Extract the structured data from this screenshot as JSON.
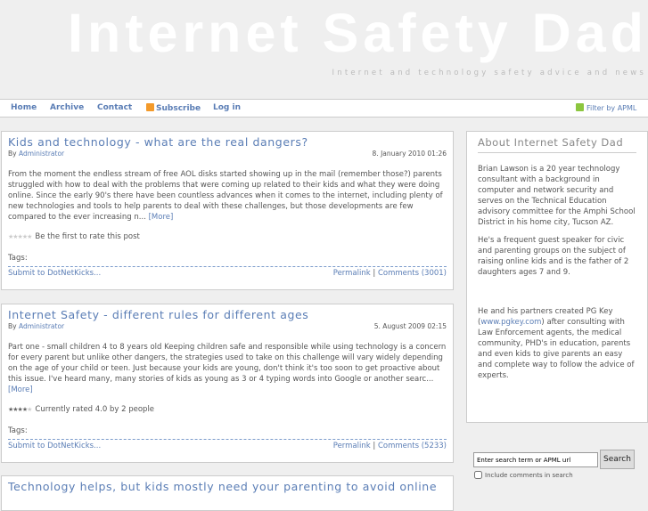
{
  "site": {
    "title": "Internet Safety Dad",
    "tagline": "Internet and technology safety advice and news"
  },
  "nav": {
    "items": [
      "Home",
      "Archive",
      "Contact",
      "Subscribe",
      "Log in"
    ],
    "filter": "Filter by APML"
  },
  "posts": [
    {
      "title": "Kids and technology - what are the real dangers?",
      "by": "By",
      "author": "Administrator",
      "date": "8. January 2010 01:26",
      "body": "  From the moment the endless stream of free AOL disks started showing up in the mail (remember those?) parents struggled with how to deal with the problems that were coming up related to their kids and what they were doing online.   Since the early 90's there have been countless advances when it comes to the internet, including plenty of new technologies and tools to help parents to deal with these challenges, but those developments are few compared to the ever increasing n...",
      "more": "[More]",
      "rating": 0,
      "rating_text": "Be the first to rate this post",
      "tags": "Tags:",
      "submit": "Submit to DotNetKicks...",
      "permalink": "Permalink",
      "comments": "Comments (3001)"
    },
    {
      "title": "Internet Safety - different rules for different ages",
      "by": "By",
      "author": "Administrator",
      "date": "5. August 2009 02:15",
      "body": "Part one - small children 4 to 8 years old   Keeping children safe and responsible while using technology is a concern for every parent but unlike other dangers, the strategies used to take on this challenge will vary widely depending on the age of your child or teen. Just because your kids are young, don't think it's too soon to get proactive about this issue.  I've heard many, many stories of kids as young as 3 or 4 typing words into Google or another searc...",
      "more": "[More]",
      "rating": 4,
      "rating_text": "Currently rated 4.0 by 2 people",
      "tags": "Tags:",
      "submit": "Submit to DotNetKicks...",
      "permalink": "Permalink",
      "comments": "Comments (5233)"
    },
    {
      "title": "Technology helps, but kids mostly need your parenting to avoid online"
    }
  ],
  "sidebar": {
    "title": "About Internet Safety Dad",
    "p1": "Brian Lawson is a 20 year technology consultant with a background in computer and network security and serves on the Technical Education advisory committee for the Amphi School District in his home city, Tucson AZ.",
    "p2": "He's a frequent guest speaker for civic and parenting groups on the subject of raising online kids and is the father of 2 daughters ages 7 and 9.",
    "p3a": "He and his partners created PG Key (",
    "p3link": "www.pgkey.com",
    "p3b": ") after consulting with Law Enforcement agents, the medical community, PHD's in education, parents and even kids to give parents an easy and complete way to follow the advice of experts."
  },
  "search": {
    "value": "Enter search term or APML url",
    "button": "Search",
    "include": "Include comments in search"
  }
}
